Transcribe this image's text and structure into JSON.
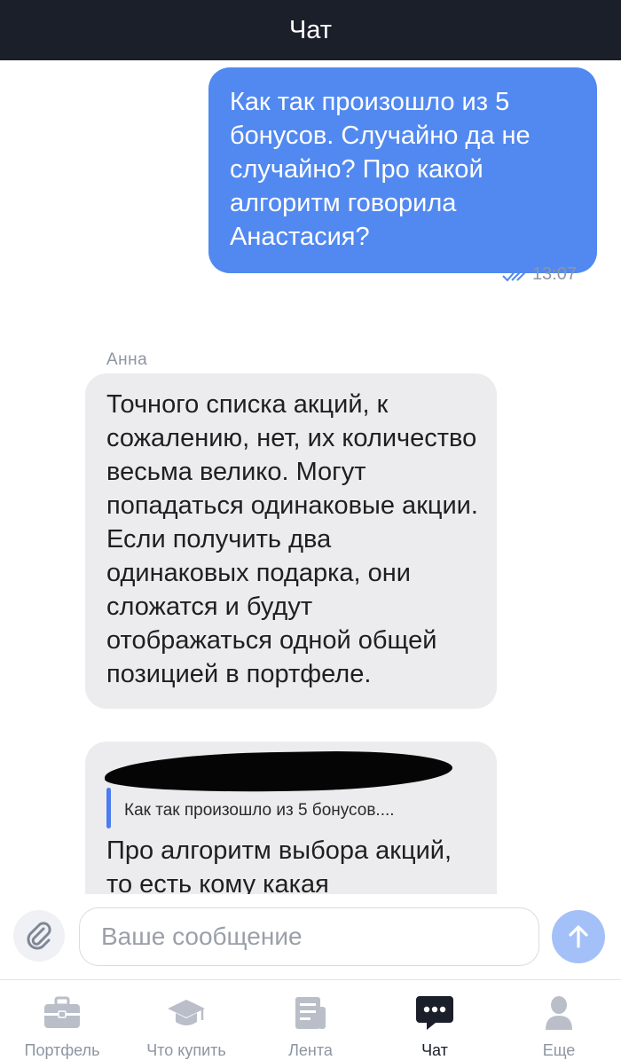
{
  "header": {
    "title": "Чат"
  },
  "messages": {
    "outgoing": {
      "text": "Как так произошло из 5 бонусов.  Случайно да не случайно? Про какой алгоритм говорила Анастасия?",
      "time": "13:07",
      "status_icon": "double-check-icon"
    },
    "sender_name": "Анна",
    "incoming_1": {
      "text": "Точного списка акций, к сожалению, нет, их количество весьма велико. Могут попадаться одинаковые акции. Если получить два одинаковых подарка, они сложатся и будут отображаться одной общей позицией в портфеле."
    },
    "incoming_2": {
      "quote": "Как так произошло из 5 бонусов....",
      "text": "Про алгоритм выбора акций, то есть кому какая"
    }
  },
  "composer": {
    "placeholder": "Ваше сообщение",
    "attach_icon": "paperclip-icon",
    "send_icon": "arrow-up-icon"
  },
  "tabs": [
    {
      "label": "Портфель",
      "icon": "briefcase-icon",
      "active": false
    },
    {
      "label": "Что купить",
      "icon": "graduation-cap-icon",
      "active": false
    },
    {
      "label": "Лента",
      "icon": "news-icon",
      "active": false
    },
    {
      "label": "Чат",
      "icon": "chat-icon",
      "active": true
    },
    {
      "label": "Еще",
      "icon": "person-icon",
      "active": false
    }
  ],
  "colors": {
    "header_bg": "#1b1f2a",
    "outgoing_bubble": "#5289f0",
    "incoming_bubble": "#ececee",
    "send_button": "#a3c1f8",
    "quote_bar": "#4d7bf0"
  }
}
